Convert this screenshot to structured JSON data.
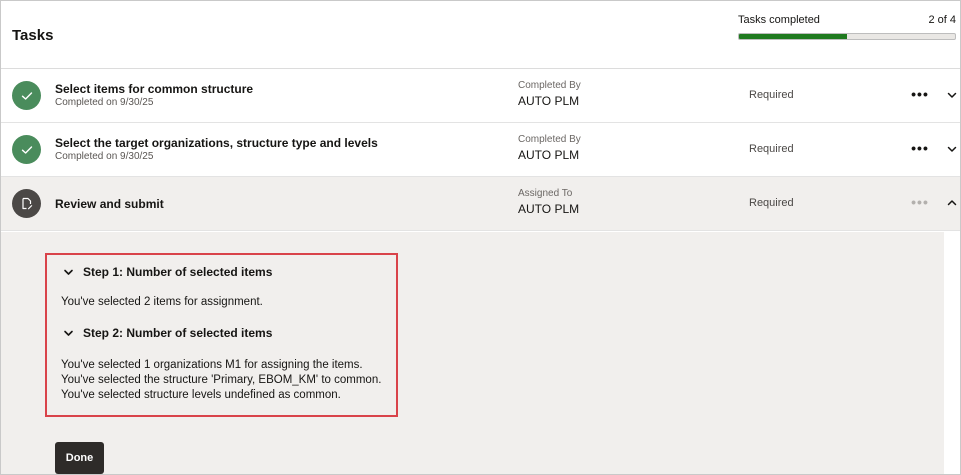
{
  "header": {
    "title": "Tasks",
    "progress_label": "Tasks completed",
    "progress_count": "2 of 4",
    "progress_fraction": 0.5
  },
  "tasks": [
    {
      "title": "Select items for common structure",
      "subtitle": "Completed on 9/30/25",
      "assignee_label": "Completed By",
      "assignee": "AUTO PLM",
      "requirement": "Required",
      "more": "•••",
      "icon": "checkmark-icon",
      "status": "completed"
    },
    {
      "title": "Select the target organizations, structure type and levels",
      "subtitle": "Completed on 9/30/25",
      "assignee_label": "Completed By",
      "assignee": "AUTO PLM",
      "requirement": "Required",
      "more": "•••",
      "icon": "checkmark-icon",
      "status": "completed"
    },
    {
      "title": "Review and submit",
      "subtitle": "",
      "assignee_label": "Assigned To",
      "assignee": "AUTO PLM",
      "requirement": "Required",
      "more": "•••",
      "icon": "document-edit-icon",
      "status": "active"
    }
  ],
  "review": {
    "step1": {
      "heading": "Step 1: Number of selected items",
      "lines": [
        "You've selected 2 items for assignment."
      ]
    },
    "step2": {
      "heading": "Step 2: Number of selected items",
      "lines": [
        "You've selected 1 organizations M1 for assigning the items.",
        "You've selected the structure 'Primary, EBOM_KM' to common.",
        "You've selected structure levels undefined as common."
      ]
    },
    "done_label": "Done"
  },
  "colors": {
    "progress_fill": "#1f7a1f",
    "completed_icon_bg": "#4a8c5c",
    "active_icon_bg": "#4b4846",
    "highlight_border": "#d9434a",
    "done_button_bg": "#2e2b29"
  }
}
